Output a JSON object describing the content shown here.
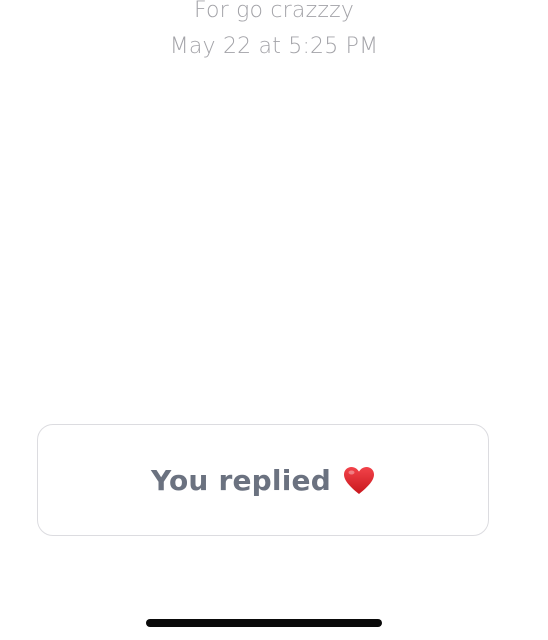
{
  "story": {
    "message": "For go crazzzy",
    "timestamp": "May 22 at 5:25 PM"
  },
  "reply_card": {
    "label": "You replied",
    "reaction_icon": "heart-icon",
    "reaction_color": "#e0262b"
  },
  "colors": {
    "caption": "#a3a3a8",
    "reply_text": "#6b7280",
    "card_border": "#dcdce0",
    "home_indicator": "#0a0a0a"
  }
}
